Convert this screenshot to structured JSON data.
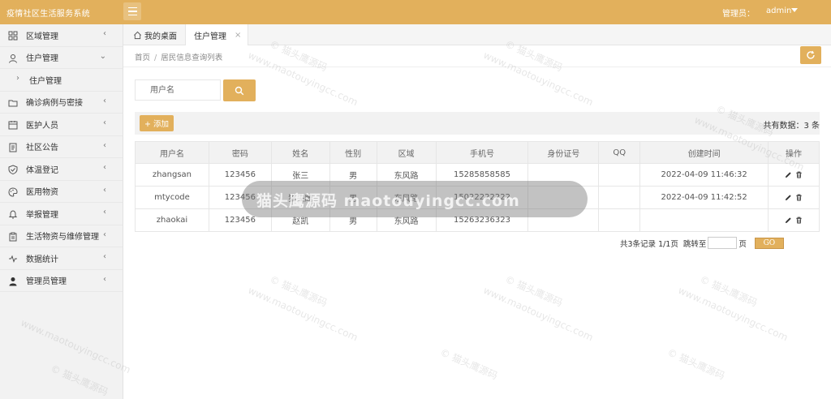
{
  "app": {
    "title": "疫情社区生活服务系统",
    "role_label": "管理员：",
    "username": "admin"
  },
  "sidebar": {
    "items": [
      {
        "label": "区域管理",
        "icon": "grid-icon"
      },
      {
        "label": "住户管理",
        "icon": "user-icon",
        "expanded": true
      },
      {
        "label": "住户管理",
        "sub": true
      },
      {
        "label": "确诊病例与密接",
        "icon": "folder-icon"
      },
      {
        "label": "医护人员",
        "icon": "calendar-icon"
      },
      {
        "label": "社区公告",
        "icon": "document-icon"
      },
      {
        "label": "体温登记",
        "icon": "shield-icon"
      },
      {
        "label": "医用物资",
        "icon": "palette-icon"
      },
      {
        "label": "举报管理",
        "icon": "bell-icon"
      },
      {
        "label": "生活物资与维修管理",
        "icon": "clipboard-icon"
      },
      {
        "label": "数据统计",
        "icon": "pulse-icon"
      },
      {
        "label": "管理员管理",
        "icon": "person-icon"
      }
    ]
  },
  "tabs": {
    "home": "我的桌面",
    "active": "住户管理",
    "close": "×"
  },
  "breadcrumb": {
    "home": "首页",
    "sep": "/",
    "current": "居民信息查询列表"
  },
  "search": {
    "placeholder": "用户名"
  },
  "toolbar": {
    "add_label": "+ 添加",
    "total_label": "共有数据：3 条"
  },
  "table": {
    "headers": [
      "用户名",
      "密码",
      "姓名",
      "性别",
      "区域",
      "手机号",
      "身份证号",
      "QQ",
      "创建时间",
      "操作"
    ],
    "rows": [
      [
        "zhangsan",
        "123456",
        "张三",
        "男",
        "东风路",
        "15285858585",
        "",
        "",
        "2022-04-09 11:46:32"
      ],
      [
        "mtycode",
        "123456",
        "猫头鹰",
        "男",
        "东风路",
        "15022222222",
        "",
        "",
        "2022-04-09 11:42:52"
      ],
      [
        "zhaokai",
        "123456",
        "赵凯",
        "男",
        "东风路",
        "15263236323",
        "",
        "",
        ""
      ]
    ]
  },
  "pager": {
    "summary": "共3条记录  1/1页",
    "jump_prefix": "跳转至",
    "jump_suffix": "页",
    "go_label": "GO"
  },
  "overlay": {
    "text": "猫头鹰源码 maotouyingcc.com"
  },
  "watermark": {
    "line1": "© 猫头鹰源码",
    "line2": "www.maotouyingcc.com"
  },
  "colors": {
    "accent": "#e2b05c",
    "sidebar_bg": "#f2f2f2",
    "header_bg": "#f2f2f2"
  }
}
